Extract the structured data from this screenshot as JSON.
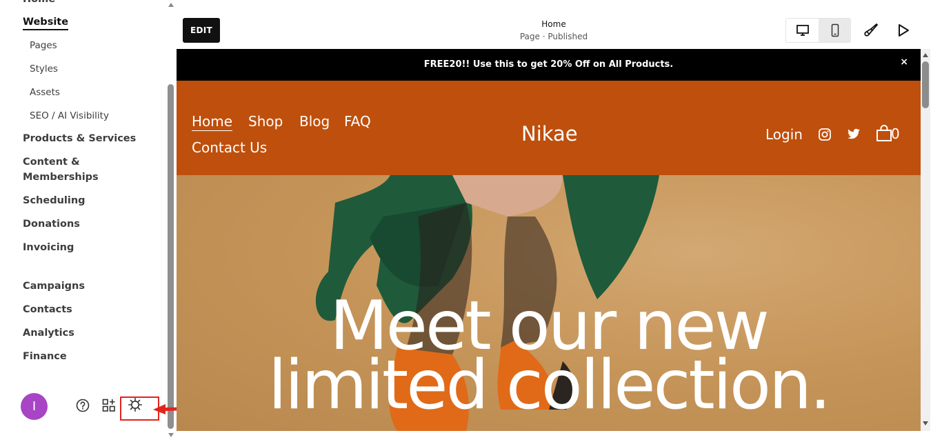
{
  "sidebar": {
    "items": [
      {
        "label": "Home"
      },
      {
        "label": "Website"
      },
      {
        "label": "Pages"
      },
      {
        "label": "Styles"
      },
      {
        "label": "Assets"
      },
      {
        "label": "SEO / AI Visibility"
      },
      {
        "label": "Products & Services"
      },
      {
        "label": "Content & Memberships"
      },
      {
        "label": "Scheduling"
      },
      {
        "label": "Donations"
      },
      {
        "label": "Invoicing"
      },
      {
        "label": "Campaigns"
      },
      {
        "label": "Contacts"
      },
      {
        "label": "Analytics"
      },
      {
        "label": "Finance"
      }
    ],
    "avatar_initial": "I",
    "icons": [
      "help-icon",
      "add-blocks-icon",
      "settings-gear-icon"
    ]
  },
  "toolbar": {
    "edit_label": "EDIT",
    "page_title": "Home",
    "page_status": "Page · Published",
    "icons": [
      "desktop-icon",
      "mobile-icon",
      "site-styles-brush-icon",
      "preview-play-icon"
    ]
  },
  "site": {
    "promo_text": "FREE20!! Use this to get 20% Off on All Products.",
    "promo_close": "×",
    "nav": [
      {
        "label": "Home"
      },
      {
        "label": "Shop"
      },
      {
        "label": "Blog"
      },
      {
        "label": "FAQ"
      },
      {
        "label": "Contact Us"
      }
    ],
    "brand": "Nikae",
    "login": "Login",
    "cart_count": "0",
    "hero_line1": "Meet our new",
    "hero_line2": "limited collection."
  },
  "colors": {
    "header_bg": "#bf4f0c",
    "promo_bg": "#000000",
    "avatar_bg": "#a845c4",
    "annotation_red": "#e3231c"
  }
}
